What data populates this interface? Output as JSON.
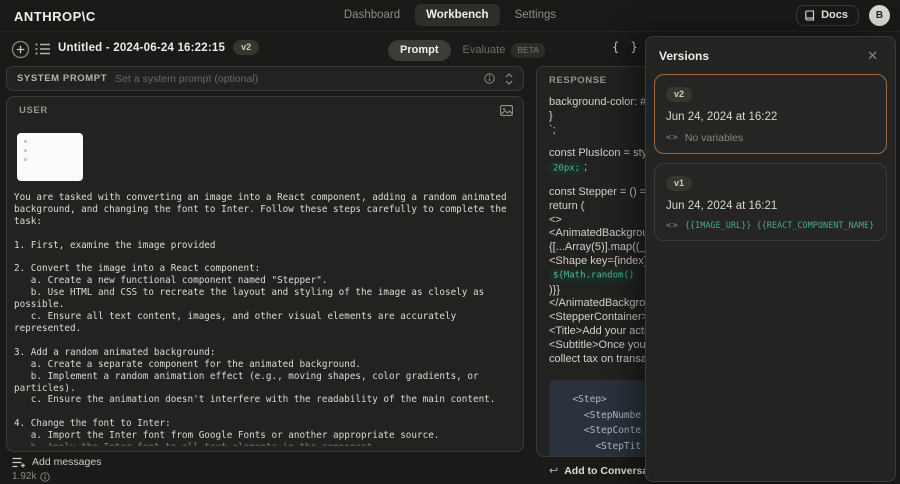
{
  "nav": {
    "logo": "ANTHROP\\C",
    "items": [
      {
        "label": "Dashboard",
        "active": false
      },
      {
        "label": "Workbench",
        "active": true
      },
      {
        "label": "Settings",
        "active": false
      }
    ],
    "docs_label": "Docs",
    "avatar_initial": "B"
  },
  "toolbar": {
    "title": "Untitled - 2024-06-24 16:22:15",
    "version_badge": "v2",
    "tabs": [
      {
        "label": "Prompt",
        "active": true
      },
      {
        "label": "Evaluate",
        "active": false,
        "badge": "BETA"
      }
    ]
  },
  "system_prompt": {
    "label": "SYSTEM PROMPT",
    "placeholder": "Set a system prompt (optional)"
  },
  "user_block": {
    "label": "USER",
    "text": "You are tasked with converting an image into a React component, adding a random animated\nbackground, and changing the font to Inter. Follow these steps carefully to complete the\ntask:\n\n1. First, examine the image provided\n\n2. Convert the image into a React component:\n   a. Create a new functional component named \"Stepper\".\n   b. Use HTML and CSS to recreate the layout and styling of the image as closely as\npossible.\n   c. Ensure all text content, images, and other visual elements are accurately\nrepresented.\n\n3. Add a random animated background:\n   a. Create a separate component for the animated background.\n   b. Implement a random animation effect (e.g., moving shapes, color gradients, or\nparticles).\n   c. Ensure the animation doesn't interfere with the readability of the main content.\n\n4. Change the font to Inter:\n   a. Import the Inter font from Google Fonts or another appropriate source.\n   b. Apply the Inter font to all text elements in the component."
  },
  "footer": {
    "add_messages": "Add messages",
    "token_count": "1.92k"
  },
  "response": {
    "label": "RESPONSE",
    "blocks": [
      {
        "lines": [
          [
            {
              "t": "text",
              "v": "background-color: #f"
            }
          ],
          [
            {
              "t": "text",
              "v": "}"
            }
          ],
          [
            {
              "t": "text",
              "v": "`;"
            }
          ]
        ]
      },
      {
        "lines": [
          [
            {
              "t": "text",
              "v": "const PlusIcon = styl"
            }
          ],
          [
            {
              "t": "code",
              "v": "20px;"
            },
            {
              "t": "text",
              "v": ";"
            }
          ]
        ]
      },
      {
        "lines": [
          [
            {
              "t": "text",
              "v": "const Stepper = () =>"
            }
          ],
          [
            {
              "t": "text",
              "v": "return ("
            }
          ],
          [
            {
              "t": "text",
              "v": "<>"
            }
          ],
          [
            {
              "t": "text",
              "v": "<AnimatedBackgrou"
            }
          ],
          [
            {
              "t": "text",
              "v": "{[...Array(5)].map((_"
            }
          ],
          [
            {
              "t": "text",
              "v": "<Shape key={index} s"
            }
          ],
          [
            {
              "t": "code",
              "v": "${Math.random()"
            }
          ],
          [
            {
              "t": "text",
              "v": ")}}"
            }
          ],
          [
            {
              "t": "text",
              "v": "</AnimatedBackgrou"
            }
          ],
          [
            {
              "t": "text",
              "v": "<StepperContainer>"
            }
          ],
          [
            {
              "t": "text",
              "v": "<Title>Add your activ"
            }
          ],
          [
            {
              "t": "text",
              "v": "<Subtitle>Once you'v"
            }
          ],
          [
            {
              "t": "text",
              "v": "collect tax on transac"
            }
          ]
        ]
      }
    ],
    "code_block": [
      "  <Step>",
      "    <StepNumbe",
      "    <StepConte",
      "      <StepTit"
    ],
    "footer_label": "Add to Conversation"
  },
  "versions_panel": {
    "title": "Versions",
    "cards": [
      {
        "badge": "v2",
        "date": "Jun 24, 2024 at 16:22",
        "vars": "No variables",
        "vars_type": "muted",
        "active": true
      },
      {
        "badge": "v1",
        "date": "Jun 24, 2024 at 16:21",
        "vars": "{{IMAGE_URL}} {{REACT_COMPONENT_NAME}}",
        "vars_type": "code",
        "active": false
      }
    ]
  },
  "colors": {
    "accent_orange": "#9c6a44",
    "code_green": "#4db89a",
    "panel_bg": "#222220",
    "page_bg": "#1a1a18",
    "code_block_bg": "#2b323d"
  }
}
